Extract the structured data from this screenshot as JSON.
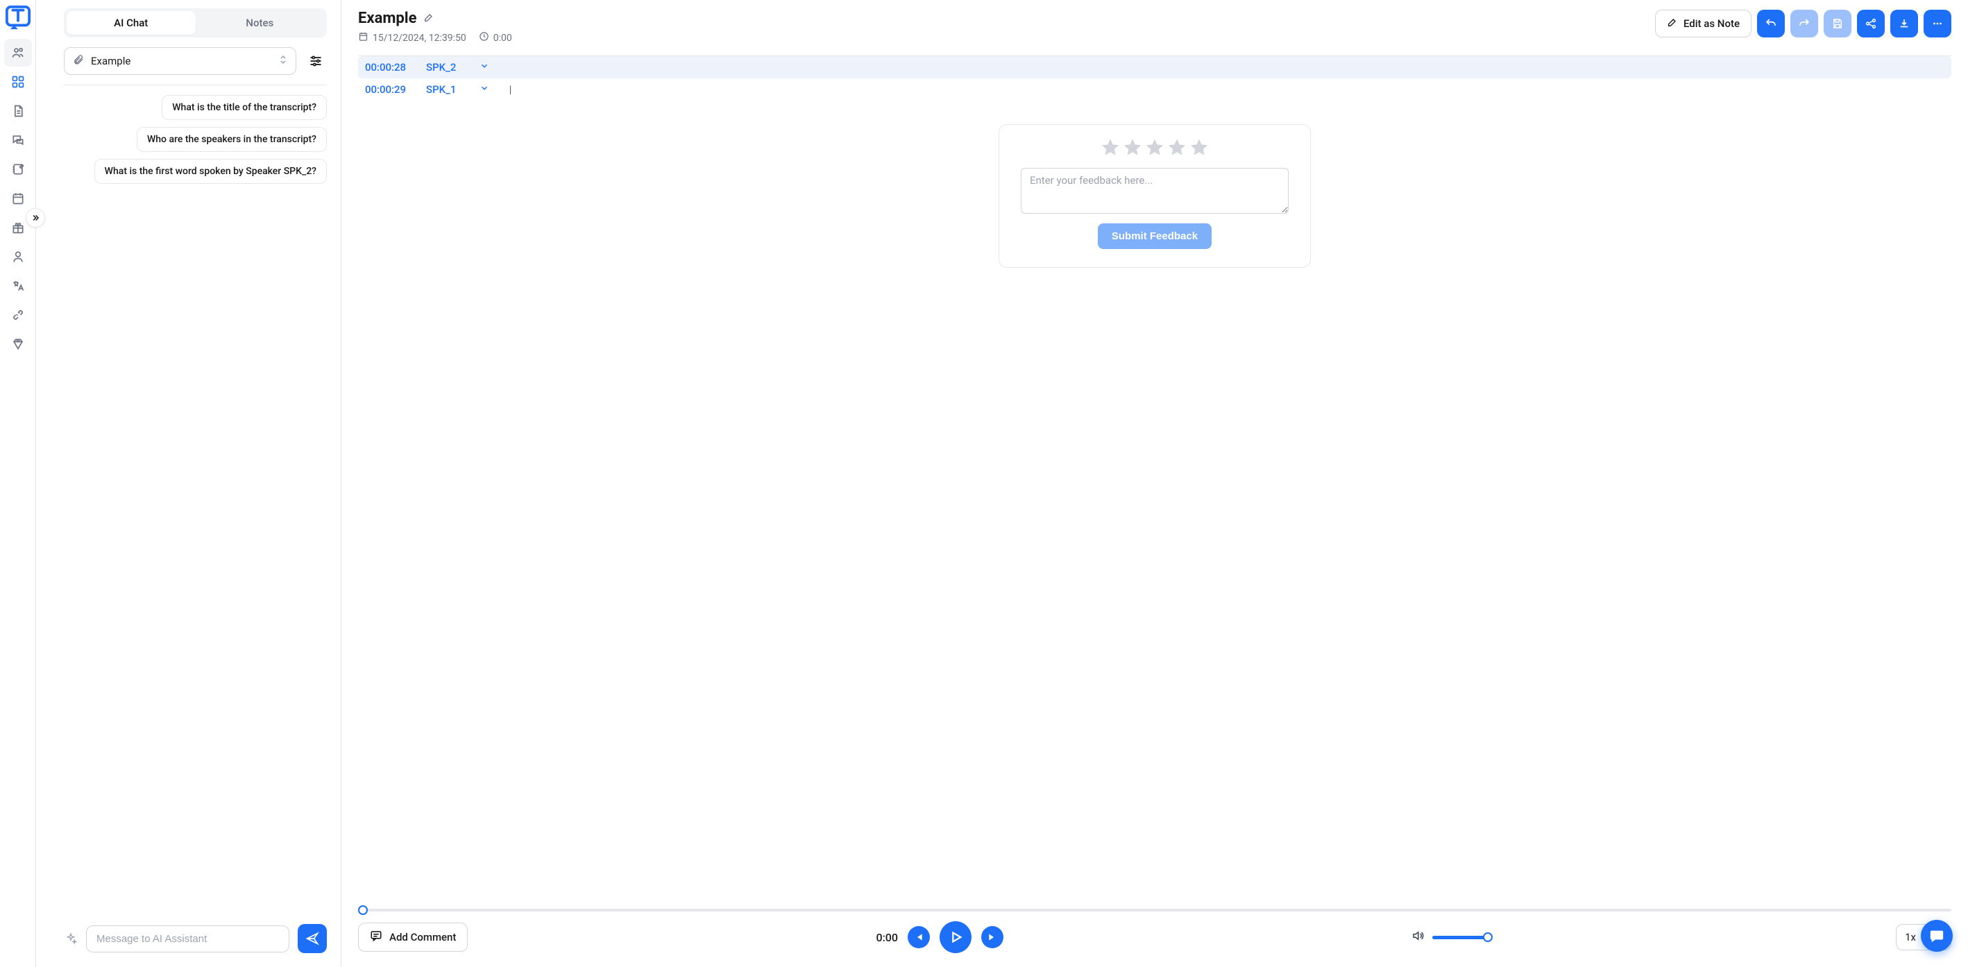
{
  "sidebar": {
    "items": [
      {
        "name": "people"
      },
      {
        "name": "dashboard"
      },
      {
        "name": "document"
      },
      {
        "name": "chat"
      },
      {
        "name": "notebook"
      },
      {
        "name": "calendar"
      },
      {
        "name": "gift"
      },
      {
        "name": "profile"
      },
      {
        "name": "translate"
      },
      {
        "name": "plug"
      },
      {
        "name": "diamond"
      }
    ]
  },
  "leftPanel": {
    "tabs": {
      "aiChat": "AI Chat",
      "notes": "Notes"
    },
    "fileName": "Example",
    "suggestions": [
      "What is the title of the transcript?",
      "Who are the speakers in the transcript?",
      "What is the first word spoken by Speaker SPK_2?"
    ],
    "inputPlaceholder": "Message to AI Assistant"
  },
  "rightPanel": {
    "title": "Example",
    "date": "15/12/2024, 12:39:50",
    "duration": "0:00",
    "editNoteLabel": "Edit as Note",
    "transcript": [
      {
        "time": "00:00:28",
        "speaker": "SPK_2",
        "selected": true
      },
      {
        "time": "00:00:29",
        "speaker": "SPK_1",
        "selected": false
      }
    ],
    "feedback": {
      "placeholder": "Enter your feedback here...",
      "submitLabel": "Submit Feedback"
    },
    "player": {
      "addComment": "Add Comment",
      "currentTime": "0:00",
      "speed": "1x"
    }
  }
}
